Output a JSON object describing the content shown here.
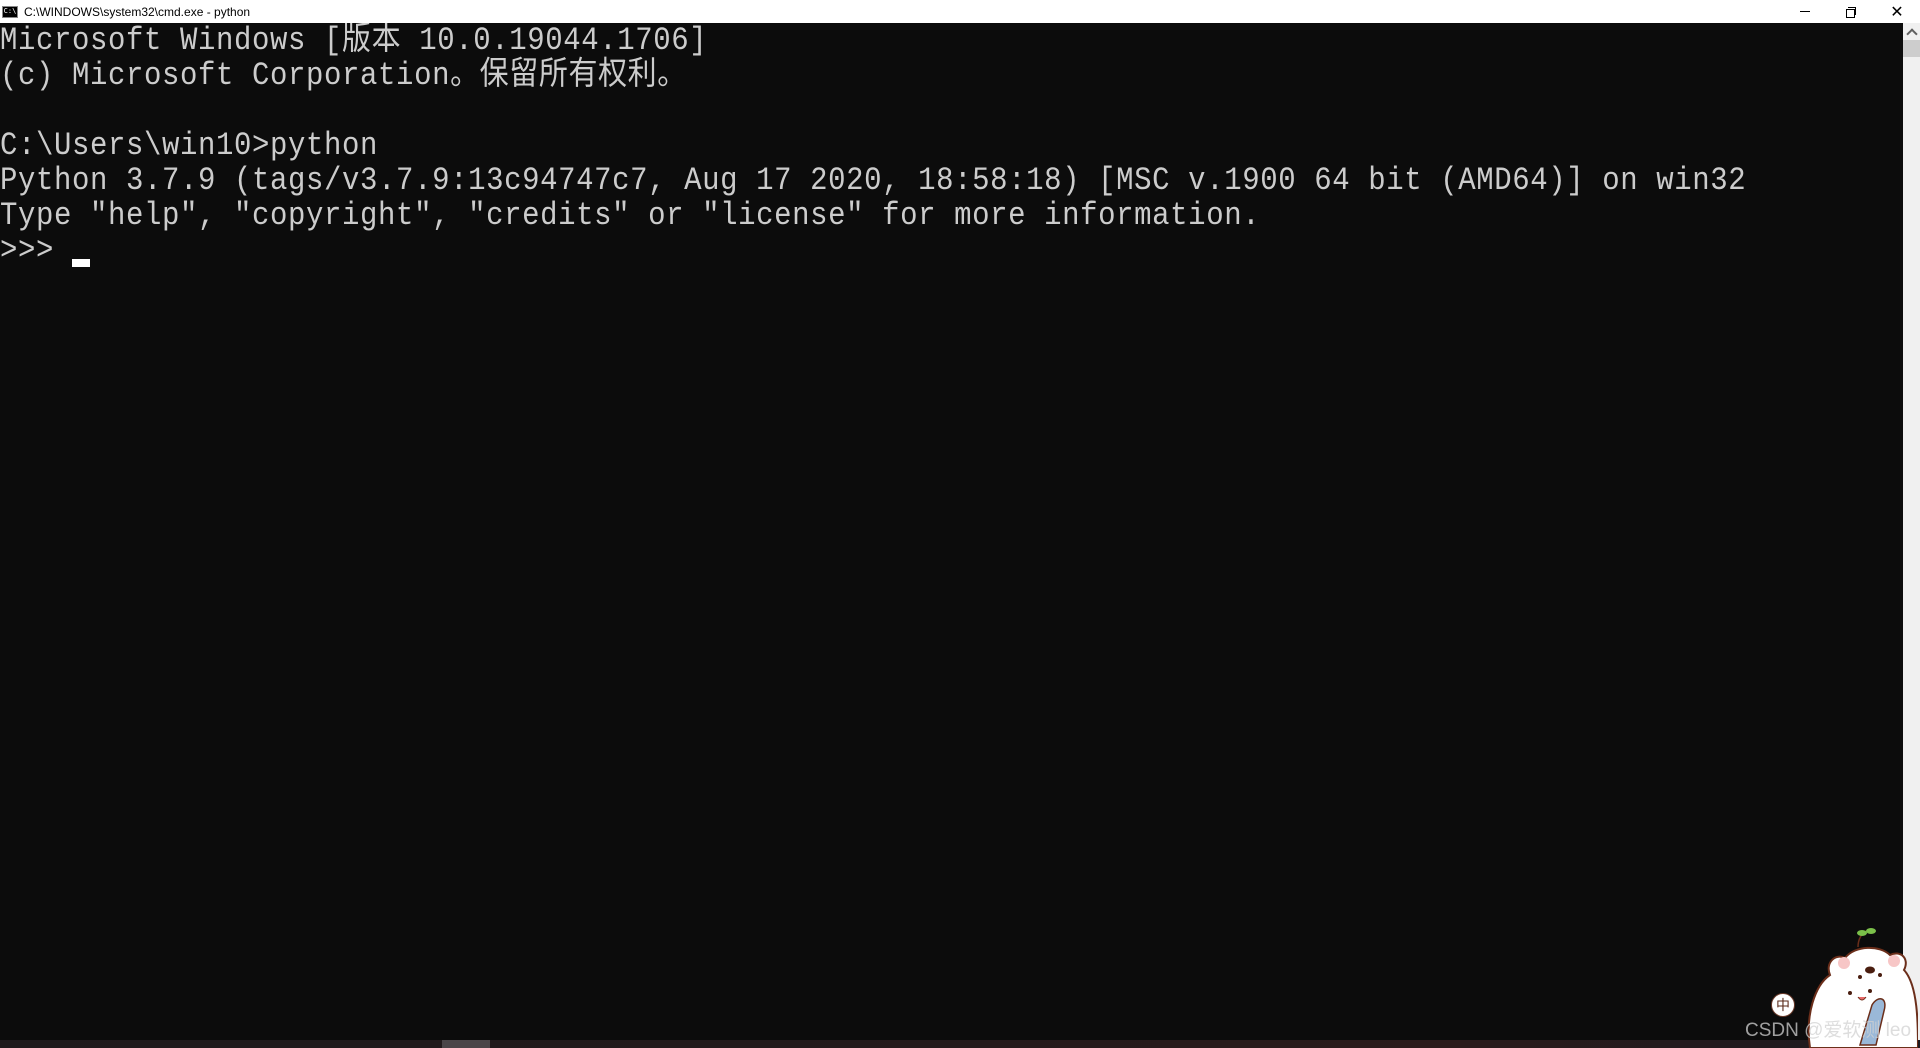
{
  "window": {
    "title": "C:\\WINDOWS\\system32\\cmd.exe - python",
    "app_icon_label": "C:\\",
    "controls": {
      "minimize": "minimize",
      "restore": "restore",
      "close": "✕"
    }
  },
  "console": {
    "lines": [
      "Microsoft Windows [版本 10.0.19044.1706]",
      "(c) Microsoft Corporation。保留所有权利。",
      "",
      "C:\\Users\\win10>python",
      "Python 3.7.9 (tags/v3.7.9:13c94747c7, Aug 17 2020, 18:58:18) [MSC v.1900 64 bit (AMD64)] on win32",
      "Type \"help\", \"copyright\", \"credits\" or \"license\" for more information.",
      ">>> "
    ],
    "prompt": ">>>"
  },
  "overlay": {
    "watermark": "CSDN @爱软测 leo",
    "ime_indicator": "中"
  },
  "colors": {
    "console_bg": "#0c0c0c",
    "console_fg": "#cccccc",
    "titlebar_bg": "#ffffff",
    "scrollbar_bg": "#f0f0f0",
    "scrollbar_thumb": "#cdcdcd"
  }
}
